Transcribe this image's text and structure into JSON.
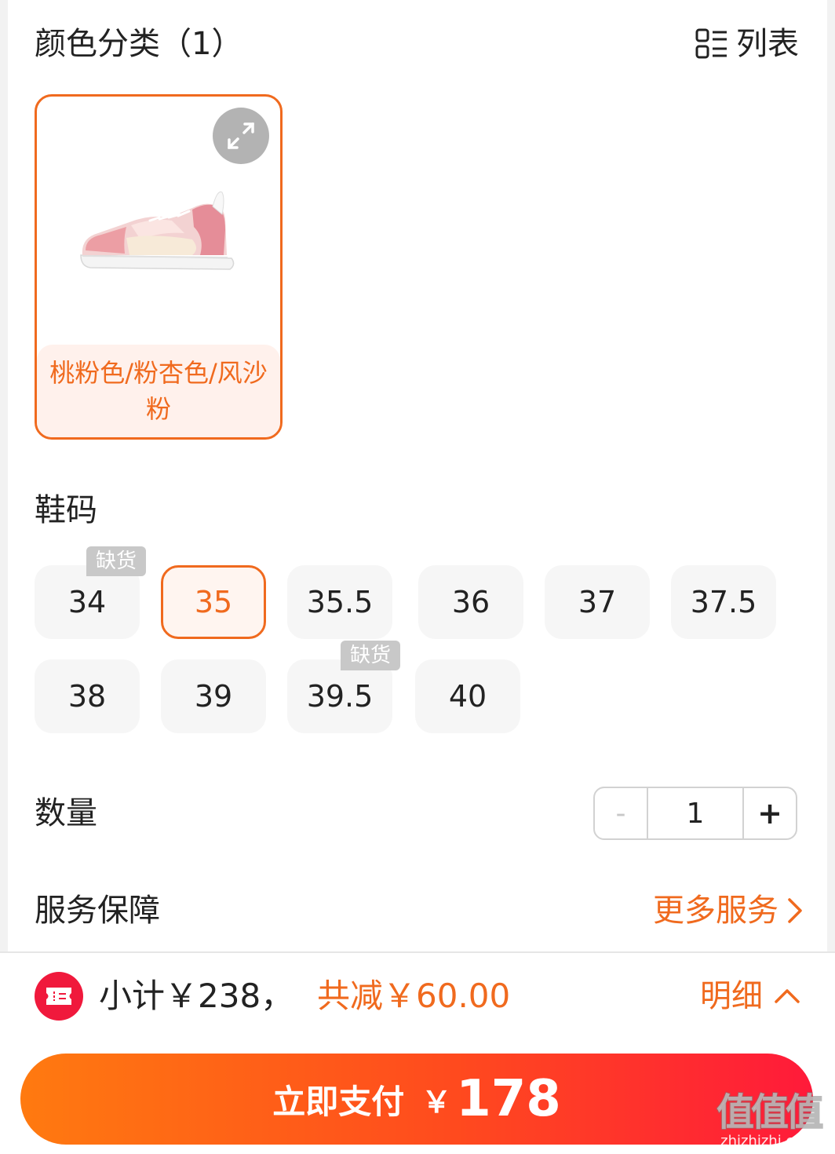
{
  "color_section": {
    "title": "颜色分类（1）",
    "list_toggle_label": "列表",
    "options": [
      {
        "label": "桃粉色/粉杏色/风沙粉",
        "selected": true
      }
    ]
  },
  "size_section": {
    "title": "鞋码",
    "out_of_stock_label": "缺货",
    "sizes": [
      {
        "label": "34",
        "out_of_stock": true,
        "selected": false
      },
      {
        "label": "35",
        "out_of_stock": false,
        "selected": true
      },
      {
        "label": "35.5",
        "out_of_stock": false,
        "selected": false
      },
      {
        "label": "36",
        "out_of_stock": false,
        "selected": false
      },
      {
        "label": "37",
        "out_of_stock": false,
        "selected": false
      },
      {
        "label": "37.5",
        "out_of_stock": false,
        "selected": false
      },
      {
        "label": "38",
        "out_of_stock": false,
        "selected": false
      },
      {
        "label": "39",
        "out_of_stock": false,
        "selected": false
      },
      {
        "label": "39.5",
        "out_of_stock": true,
        "selected": false
      },
      {
        "label": "40",
        "out_of_stock": false,
        "selected": false
      }
    ]
  },
  "quantity_section": {
    "title": "数量",
    "minus": "-",
    "value": "1",
    "plus": "+"
  },
  "service_section": {
    "title": "服务保障",
    "more_label": "更多服务"
  },
  "footer": {
    "subtotal": "小计￥238，",
    "discount": "共减￥60.00",
    "details_label": "明细",
    "pay_label": "立即支付",
    "pay_currency": "￥",
    "pay_amount": "178"
  },
  "watermark": {
    "logo": "值值值",
    "url": "zhizhizhi.com"
  },
  "colors": {
    "accent": "#f06a1e",
    "coupon_red": "#f0193c",
    "pay_gradient_start": "#ff7a10",
    "pay_gradient_end": "#ff1a3a"
  }
}
